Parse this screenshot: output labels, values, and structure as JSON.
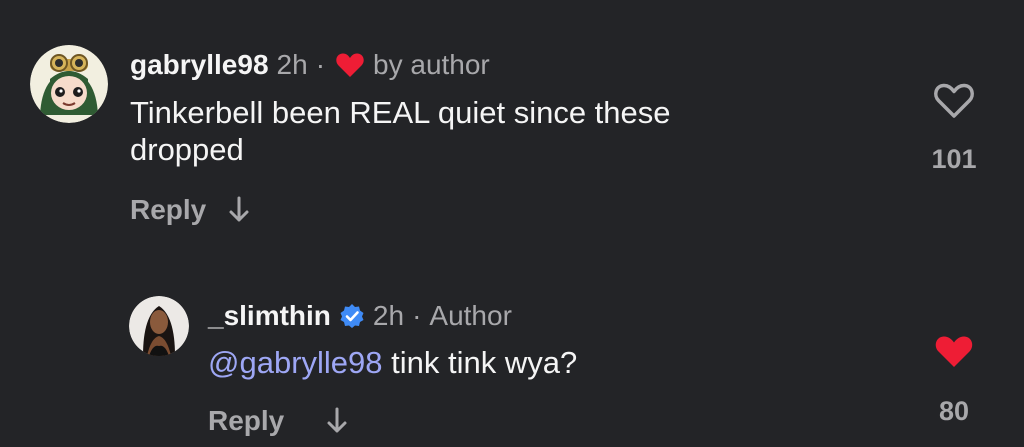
{
  "comments": [
    {
      "username": "gabrylle98",
      "time": "2h",
      "separator": "·",
      "author_like_label": "by author",
      "text": "Tinkerbell been REAL quiet since these dropped",
      "reply_label": "Reply",
      "likes": "101",
      "liked": false,
      "heart_color": "#ee1d35",
      "avatar": "anime-frog-girl-avatar"
    },
    {
      "username": "_slimthin",
      "verified": true,
      "verified_color": "#3f8bf6",
      "time": "2h",
      "separator": "·",
      "author_label": "Author",
      "mention": "@gabrylle98",
      "text": " tink tink wya?",
      "reply_label": "Reply",
      "likes": "80",
      "liked": true,
      "heart_color": "#ee1d35",
      "avatar": "woman-portrait-avatar"
    }
  ],
  "colors": {
    "background": "#232427",
    "primary_text": "#f5f5f5",
    "secondary_text": "#a8a8ab",
    "mention": "#9ea7f5"
  }
}
